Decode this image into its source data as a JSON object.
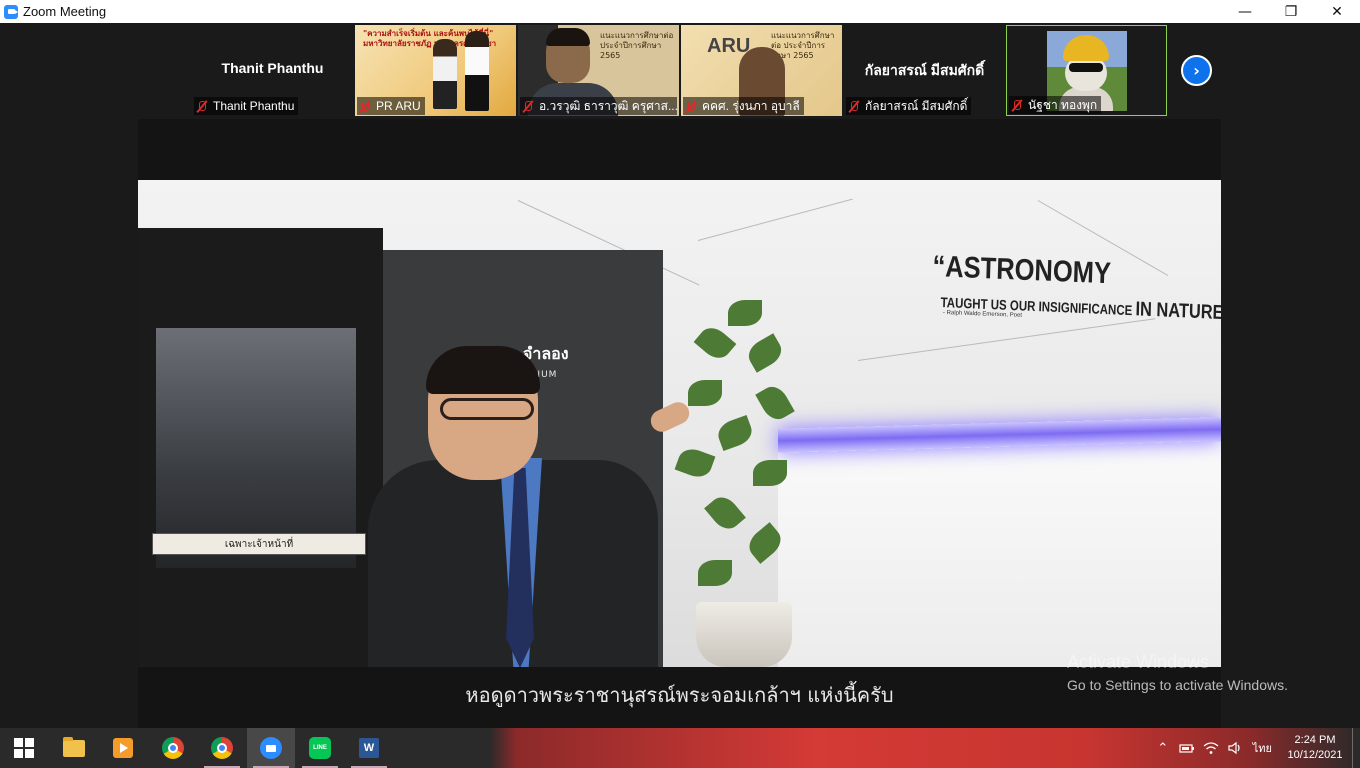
{
  "window": {
    "title": "Zoom Meeting",
    "controls": {
      "minimize": "—",
      "restore": "❐",
      "close": "✕"
    }
  },
  "participants": [
    {
      "big_name": "Thanit Phanthu",
      "label": "Thanit Phanthu",
      "muted": true
    },
    {
      "big_name": "",
      "label": "PR ARU",
      "muted": true
    },
    {
      "big_name": "",
      "label": "อ.วรวุฒิ ธาราวุฒิ ครุศาส...",
      "muted": true
    },
    {
      "big_name": "",
      "label": "คคศ. รุ่งนภา อุบาลี",
      "muted": true
    },
    {
      "big_name": "กัลยาสรณ์ มีสมศักดิ์",
      "label": "กัลยาสรณ์ มีสมศักดิ์",
      "muted": true
    },
    {
      "big_name": "",
      "label": "นัฐชา ทองพุก",
      "muted": true,
      "active": true
    }
  ],
  "thumbnails": {
    "poster_text": "\"ความสำเร็จเริ่มต้น และค้นพบได้ที่นี่\"",
    "poster_sub": "มหาวิทยาลัยราชภัฏ พระนครศรีอยุธยา",
    "cam_text": "แนะแนวการศึกษาต่อ ประจำปีการศึกษา 2565",
    "back_brand": "ARU",
    "back_text": "แนะแนวการศึกษาต่อ ประจำปีการศึกษา 2565"
  },
  "next_button": "›",
  "video": {
    "quote_line1": "“ASTRONOMY",
    "quote_line2_small": "TAUGHT US OUR INSIGNIFICANCE ",
    "quote_line2_big": "IN NATURE”",
    "quote_author": "- Ralph Waldo Emerson, Poet",
    "panel_text": "จำลอง",
    "panel_sub": "ARIUM",
    "door_sign": "เฉพาะเจ้าหน้าที่",
    "subtitle": "หอดูดาวพระราชานุสรณ์พระจอมเกล้าฯ แห่งนี้ครับ"
  },
  "watermark": {
    "line1": "Activate Windows",
    "line2": "Go to Settings to activate Windows."
  },
  "taskbar": {
    "apps": [
      {
        "name": "start",
        "running": false,
        "selected": false
      },
      {
        "name": "file-explorer",
        "running": false,
        "selected": false
      },
      {
        "name": "media-player",
        "running": false,
        "selected": false
      },
      {
        "name": "chrome",
        "running": false,
        "selected": false
      },
      {
        "name": "chrome",
        "running": true,
        "selected": false
      },
      {
        "name": "zoom",
        "running": true,
        "selected": true
      },
      {
        "name": "line",
        "running": true,
        "selected": false
      },
      {
        "name": "word",
        "running": true,
        "selected": false
      }
    ],
    "line_label": "LINE",
    "word_label": "W",
    "tray": {
      "chevron": "⌃",
      "language": "ไทย",
      "time": "2:24 PM",
      "date": "10/12/2021"
    }
  }
}
